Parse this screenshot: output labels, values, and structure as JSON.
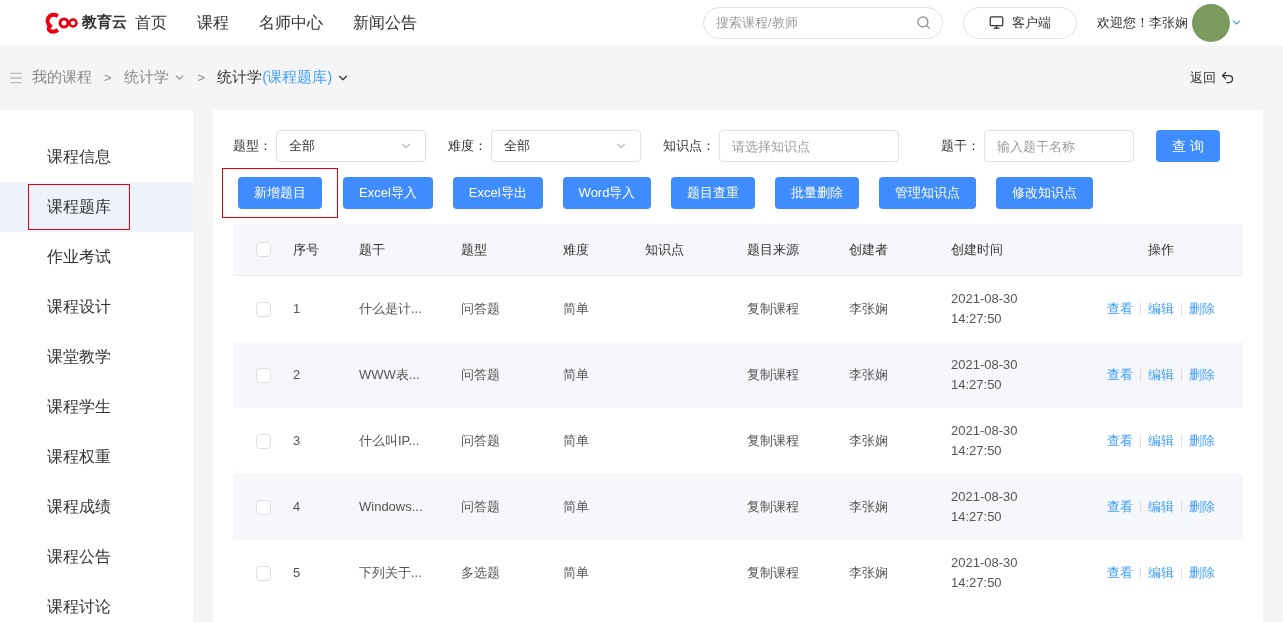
{
  "header": {
    "logo_text": "教育云",
    "nav": [
      {
        "label": "首页"
      },
      {
        "label": "课程"
      },
      {
        "label": "名师中心"
      },
      {
        "label": "新闻公告"
      }
    ],
    "search": {
      "placeholder": "搜索课程/教师"
    },
    "client_button": "客户端",
    "welcome": "欢迎您！李张娴"
  },
  "breadcrumb": {
    "items": [
      {
        "label": "我的课程",
        "dropdown": false,
        "separator": ">"
      },
      {
        "label": "统计学",
        "dropdown": true,
        "separator": ">"
      }
    ],
    "current": "统计学",
    "current_sub": "(课程题库)",
    "back": "返回"
  },
  "sidebar": {
    "items": [
      {
        "label": "课程信息",
        "selected": false,
        "highlighted": false
      },
      {
        "label": "课程题库",
        "selected": true,
        "highlighted": true
      },
      {
        "label": "作业考试",
        "selected": false,
        "highlighted": false
      },
      {
        "label": "课程设计",
        "selected": false,
        "highlighted": false
      },
      {
        "label": "课堂教学",
        "selected": false,
        "highlighted": false
      },
      {
        "label": "课程学生",
        "selected": false,
        "highlighted": false
      },
      {
        "label": "课程权重",
        "selected": false,
        "highlighted": false
      },
      {
        "label": "课程成绩",
        "selected": false,
        "highlighted": false
      },
      {
        "label": "课程公告",
        "selected": false,
        "highlighted": false
      },
      {
        "label": "课程讨论",
        "selected": false,
        "highlighted": false
      }
    ]
  },
  "filters": [
    {
      "kind": "select",
      "label": "题型：",
      "value": "全部"
    },
    {
      "kind": "select",
      "label": "难度：",
      "value": "全部"
    },
    {
      "kind": "input",
      "label": "知识点：",
      "placeholder": "请选择知识点"
    },
    {
      "kind": "input",
      "label": "题干：",
      "placeholder": "输入题干名称"
    }
  ],
  "query_button": "查 询",
  "actions": [
    {
      "label": "新增题目",
      "highlighted": true
    },
    {
      "label": "Excel导入",
      "highlighted": false
    },
    {
      "label": "Excel导出",
      "highlighted": false
    },
    {
      "label": "Word导入",
      "highlighted": false
    },
    {
      "label": "题目查重",
      "highlighted": false
    },
    {
      "label": "批量删除",
      "highlighted": false
    },
    {
      "label": "管理知识点",
      "highlighted": false
    },
    {
      "label": "修改知识点",
      "highlighted": false
    }
  ],
  "table": {
    "all_checked": false,
    "columns": [
      "序号",
      "题干",
      "题型",
      "难度",
      "知识点",
      "题目来源",
      "创建者",
      "创建时间",
      "操作"
    ],
    "rows": [
      {
        "checked": false,
        "no": "1",
        "stem": "什么是计...",
        "type": "问答题",
        "difficulty": "简单",
        "source": "复制课程",
        "creator": "李张娴",
        "date": "2021-08-30",
        "time": "14:27:50",
        "ops": [
          "查看",
          "编辑",
          "删除"
        ]
      },
      {
        "checked": false,
        "no": "2",
        "stem": "WWW表...",
        "type": "问答题",
        "difficulty": "简单",
        "source": "复制课程",
        "creator": "李张娴",
        "date": "2021-08-30",
        "time": "14:27:50",
        "ops": [
          "查看",
          "编辑",
          "删除"
        ]
      },
      {
        "checked": false,
        "no": "3",
        "stem": "什么叫IP...",
        "type": "问答题",
        "difficulty": "简单",
        "source": "复制课程",
        "creator": "李张娴",
        "date": "2021-08-30",
        "time": "14:27:50",
        "ops": [
          "查看",
          "编辑",
          "删除"
        ]
      },
      {
        "checked": false,
        "no": "4",
        "stem": "Windows...",
        "type": "问答题",
        "difficulty": "简单",
        "source": "复制课程",
        "creator": "李张娴",
        "date": "2021-08-30",
        "time": "14:27:50",
        "ops": [
          "查看",
          "编辑",
          "删除"
        ]
      },
      {
        "checked": false,
        "no": "5",
        "stem": "下列关于...",
        "type": "多选题",
        "difficulty": "简单",
        "source": "复制课程",
        "creator": "李张娴",
        "date": "2021-08-30",
        "time": "14:27:50",
        "ops": [
          "查看",
          "编辑",
          "删除"
        ]
      }
    ]
  }
}
